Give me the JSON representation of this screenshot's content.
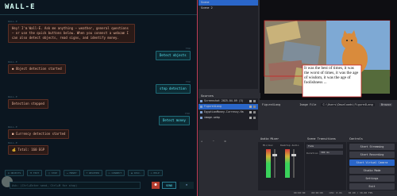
{
  "chat": {
    "logo": "WALL-E",
    "messages": [
      {
        "meta": "WALL-E",
        "text": "Hey! I'm Wall-E. Ask me anything — weather, general questions — or use the quick buttons below. When you connect a webcam I can also detect objects, read signs, and identify money.",
        "role": "assistant"
      },
      {
        "meta": "YOU",
        "text": "Detect objects",
        "role": "user"
      },
      {
        "meta": "WALL-E",
        "text": "● Object detection started",
        "role": "assistant"
      },
      {
        "meta": "YOU",
        "text": "stop detection",
        "role": "user"
      },
      {
        "meta": "WALL-E",
        "text": "Detection stopped",
        "role": "assistant"
      },
      {
        "meta": "YOU",
        "text": "Detect money",
        "role": "user"
      },
      {
        "meta": "WALL-E",
        "text": "■ Currency detection started",
        "role": "assistant"
      },
      {
        "meta": "WALL-E",
        "text": "💰 Total: 160 EGP",
        "role": "assistant"
      }
    ],
    "chips": [
      "◎ OBJECTS",
      "⚑ TEXT",
      "□ STOP",
      "¤ MONEY",
      "☀ WEATHER",
      "▷ CONNECT",
      "◉ DISC.",
      "◇ HELP"
    ],
    "input_placeholder": "Ask: (Ctrl+Enter send, Ctrl+M for stop)",
    "mic_label": "●",
    "send_label": "SEND",
    "menu_label": "≡"
  },
  "obs": {
    "scenes": [
      "Scene",
      "Scene 2"
    ],
    "active_scene": 0,
    "sources_title": "Sources",
    "sources": [
      {
        "name": "Screenshot 2025-04-09 (3)",
        "active": false
      },
      {
        "name": "Figure4Lang",
        "active": true
      },
      {
        "name": "EgyptianMoney-Currency-Ha",
        "active": false
      },
      {
        "name": "image.webp",
        "active": false
      }
    ],
    "preview_text": "It was the best of times, it was the worst of times, it was the age of wisdom, it was the age of foolishness ...",
    "prop_label": "Figure4Lang",
    "prop_image_file": "Image File",
    "prop_path": "C:\\Users\\Downloads\\Figure4Lang",
    "prop_browse": "Browse",
    "mixer_title": "Audio Mixer",
    "mixer_channels": [
      "Mic/Aux",
      "Desktop Audio"
    ],
    "transitions_title": "Scene Transitions",
    "transition_type": "Fade",
    "duration_label": "Duration",
    "duration_value": "300 ms",
    "controls_title": "Controls",
    "controls": [
      {
        "label": "Start Streaming",
        "active": false
      },
      {
        "label": "Start Recording",
        "active": false
      },
      {
        "label": "Start Virtual Camera",
        "active": true
      },
      {
        "label": "Studio Mode",
        "active": false
      },
      {
        "label": "Settings",
        "active": false
      },
      {
        "label": "Exit",
        "active": false
      }
    ],
    "status": [
      "00:00:00",
      "00:00:00",
      "CPU: 0.9%",
      "30.00 / 30.00 FPS"
    ],
    "accent": "#2a66c9"
  }
}
